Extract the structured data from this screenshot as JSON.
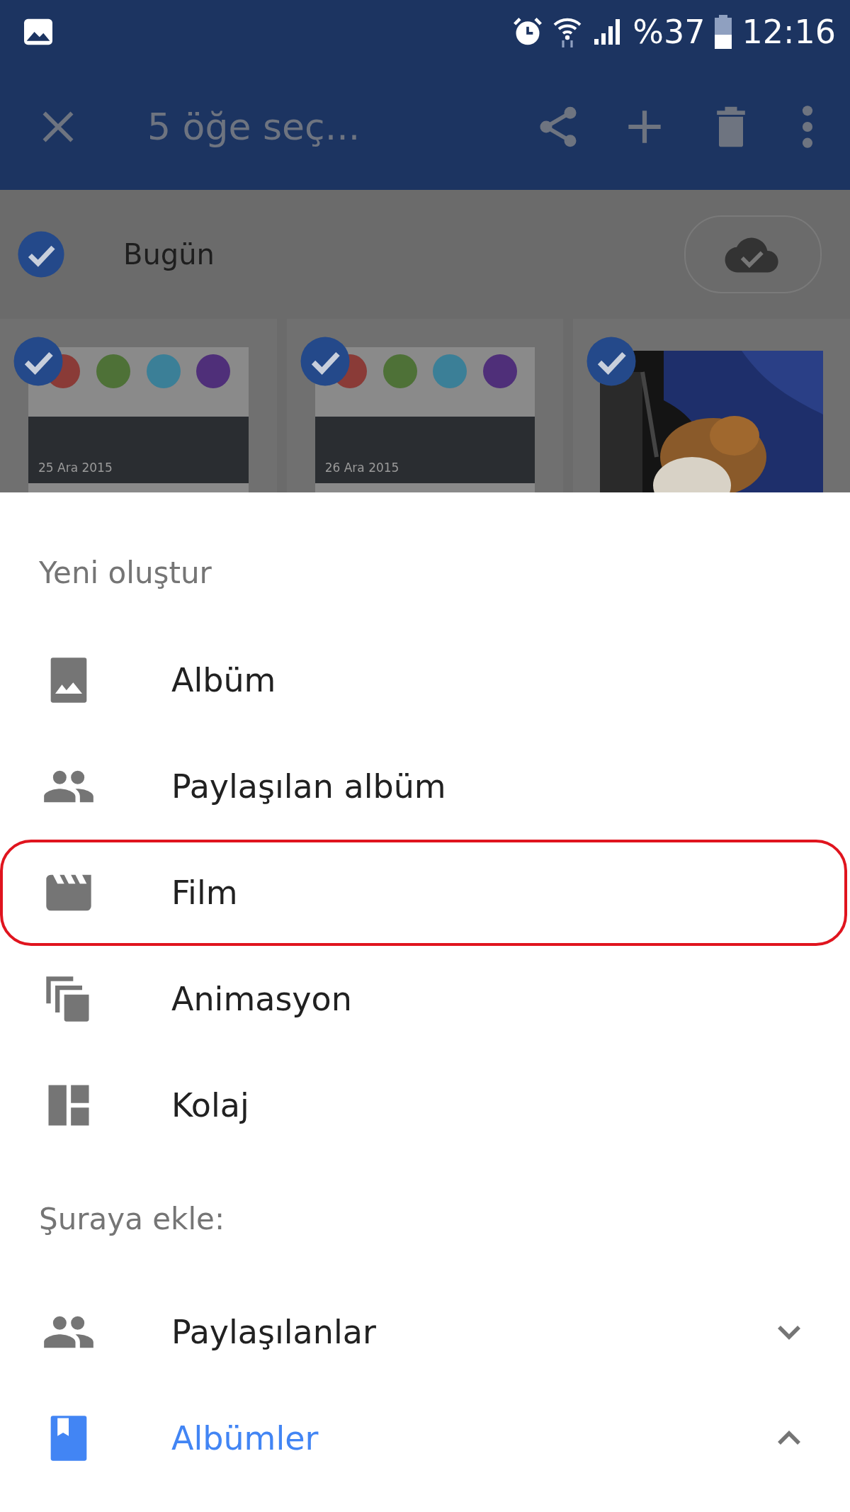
{
  "status_bar": {
    "battery": "%37",
    "time": "12:16"
  },
  "app_bar": {
    "title": "5 öğe seç..."
  },
  "day_group": {
    "title": "Bugün",
    "selected": true
  },
  "thumbnails": [
    {
      "kind": "screenshot",
      "selected": true,
      "date": "25 Ara 2015"
    },
    {
      "kind": "screenshot",
      "selected": true,
      "date": "26 Ara 2015"
    },
    {
      "kind": "picture",
      "selected": true
    }
  ],
  "sheet": {
    "sections": [
      {
        "heading": "Yeni oluştur",
        "items": [
          {
            "kind": "album",
            "label": "Albüm",
            "highlighted": false
          },
          {
            "kind": "shared",
            "label": "Paylaşılan albüm",
            "highlighted": false
          },
          {
            "kind": "film",
            "label": "Film",
            "highlighted": true
          },
          {
            "kind": "animation",
            "label": "Animasyon",
            "highlighted": false
          },
          {
            "kind": "collage",
            "label": "Kolaj",
            "highlighted": false
          }
        ]
      },
      {
        "heading": "Şuraya ekle:",
        "items": [
          {
            "kind": "shared",
            "label": "Paylaşılanlar",
            "highlighted": false,
            "expanded": false,
            "active": false
          },
          {
            "kind": "albums",
            "label": "Albümler",
            "highlighted": false,
            "expanded": true,
            "active": true
          }
        ]
      }
    ]
  }
}
